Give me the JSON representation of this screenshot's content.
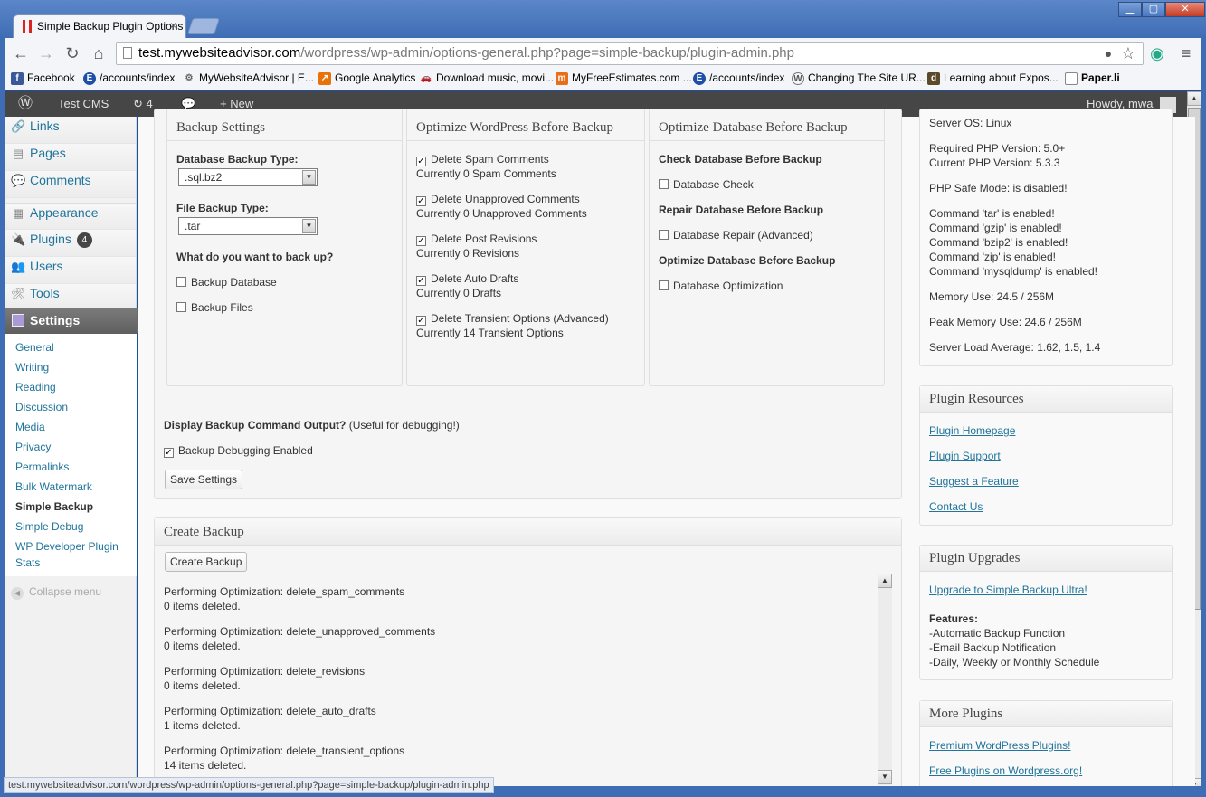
{
  "browser": {
    "tab_title": "Simple Backup Plugin Options",
    "url_host": "test.mywebsiteadvisor.com",
    "url_path": "/wordpress/wp-admin/options-general.php?page=simple-backup/plugin-admin.php",
    "status_url": "test.mywebsiteadvisor.com/wordpress/wp-admin/options-general.php?page=simple-backup/plugin-admin.php"
  },
  "bookmarks": [
    "Facebook",
    "/accounts/index",
    "MyWebsiteAdvisor | E...",
    "Google Analytics",
    "Download music, movi...",
    "MyFreeEstimates.com ...",
    "/accounts/index",
    "Changing The Site UR...",
    "Learning about Expos...",
    "Paper.li"
  ],
  "adminbar": {
    "site": "Test CMS",
    "updates": "4",
    "new": "New",
    "howdy": "Howdy, mwa"
  },
  "menu": {
    "links": "Links",
    "pages": "Pages",
    "comments": "Comments",
    "appearance": "Appearance",
    "plugins": "Plugins",
    "plugins_badge": "4",
    "users": "Users",
    "tools": "Tools",
    "settings": "Settings",
    "collapse": "Collapse menu",
    "submenu": [
      "General",
      "Writing",
      "Reading",
      "Discussion",
      "Media",
      "Privacy",
      "Permalinks",
      "Bulk Watermark",
      "Simple Backup",
      "Simple Debug",
      "WP Developer Plugin",
      "Stats"
    ]
  },
  "backup_settings": {
    "title": "Backup Settings",
    "db_type_label": "Database Backup Type:",
    "db_type_value": ".sql.bz2",
    "file_type_label": "File Backup Type:",
    "file_type_value": ".tar",
    "what_label": "What do you want to back up?",
    "backup_database": "Backup Database",
    "backup_files": "Backup Files"
  },
  "optimize_wp": {
    "title": "Optimize WordPress Before Backup",
    "items": [
      {
        "label": "Delete Spam Comments",
        "sub": "Currently 0 Spam Comments"
      },
      {
        "label": "Delete Unapproved Comments",
        "sub": "Currently 0 Unapproved Comments"
      },
      {
        "label": "Delete Post Revisions",
        "sub": "Currently 0 Revisions"
      },
      {
        "label": "Delete Auto Drafts",
        "sub": "Currently 0 Drafts"
      },
      {
        "label": "Delete Transient Options (Advanced)",
        "sub": "Currently 14 Transient Options"
      }
    ]
  },
  "optimize_db": {
    "title": "Optimize Database Before Backup",
    "check_h": "Check Database Before Backup",
    "check": "Database Check",
    "repair_h": "Repair Database Before Backup",
    "repair": "Database Repair (Advanced)",
    "opt_h": "Optimize Database Before Backup",
    "opt": "Database Optimization"
  },
  "debug": {
    "label": "Display Backup Command Output?",
    "hint": "(Useful for debugging!)",
    "checkbox": "Backup Debugging Enabled",
    "save": "Save Settings"
  },
  "create": {
    "title": "Create Backup",
    "button": "Create Backup",
    "log": [
      [
        "Performing Optimization: delete_spam_comments",
        "0 items deleted."
      ],
      [
        "Performing Optimization: delete_unapproved_comments",
        "0 items deleted."
      ],
      [
        "Performing Optimization: delete_revisions",
        "0 items deleted."
      ],
      [
        "Performing Optimization: delete_auto_drafts",
        "1 items deleted."
      ],
      [
        "Performing Optimization: delete_transient_options",
        "14 items deleted."
      ]
    ]
  },
  "server": {
    "lines": [
      "Server OS: Linux",
      "Required PHP Version: 5.0+",
      "Current PHP Version: 5.3.3",
      "PHP Safe Mode: is disabled!",
      "Command 'tar' is enabled!",
      "Command 'gzip' is enabled!",
      "Command 'bzip2' is enabled!",
      "Command 'zip' is enabled!",
      "Command 'mysqldump' is enabled!",
      "Memory Use: 24.5 / 256M",
      "Peak Memory Use: 24.6 / 256M",
      "Server Load Average: 1.62, 1.5, 1.4"
    ]
  },
  "resources": {
    "title": "Plugin Resources",
    "links": [
      "Plugin Homepage",
      "Plugin Support",
      "Suggest a Feature",
      "Contact Us"
    ]
  },
  "upgrades": {
    "title": "Plugin Upgrades",
    "link": "Upgrade to Simple Backup Ultra!",
    "features": "Features:",
    "list": [
      "-Automatic Backup Function",
      "-Email Backup Notification",
      "-Daily, Weekly or Monthly Schedule"
    ]
  },
  "more": {
    "title": "More Plugins",
    "links": [
      "Premium WordPress Plugins!",
      "Free Plugins on Wordpress.org!"
    ]
  }
}
